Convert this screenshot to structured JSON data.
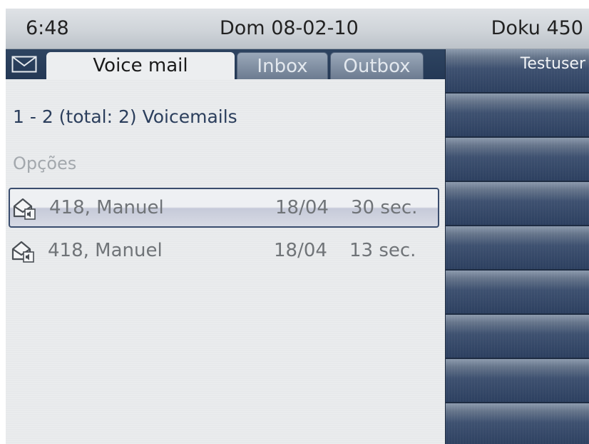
{
  "status_bar": {
    "time": "6:48",
    "date": "Dom 08-02-10",
    "user": "Doku 450"
  },
  "tabs": [
    {
      "label": "Voice mail",
      "active": true
    },
    {
      "label": "Inbox",
      "active": false
    },
    {
      "label": "Outbox",
      "active": false
    }
  ],
  "summary": "1 - 2 (total: 2) Voicemails",
  "options_label": "Opções",
  "messages": [
    {
      "caller": "418, Manuel",
      "date": "18/04",
      "duration": "30 sec.",
      "selected": true,
      "icon": "voicemail-envelope-icon"
    },
    {
      "caller": "418, Manuel",
      "date": "18/04",
      "duration": "13 sec.",
      "selected": false,
      "icon": "voicemail-envelope-icon"
    }
  ],
  "key_panel": {
    "keys": [
      {
        "label": "Testuser"
      },
      {
        "label": ""
      },
      {
        "label": ""
      },
      {
        "label": ""
      },
      {
        "label": ""
      },
      {
        "label": ""
      },
      {
        "label": ""
      },
      {
        "label": ""
      },
      {
        "label": ""
      }
    ]
  },
  "colors": {
    "accent_dark": "#2a3d59",
    "summary_text": "#2b3e5c",
    "inactive_tab": "#7c8ba0"
  }
}
